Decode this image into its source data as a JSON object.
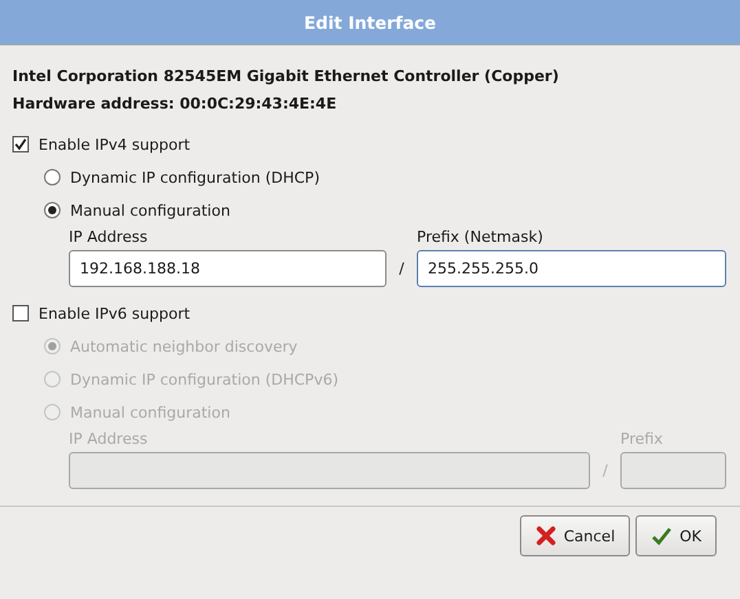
{
  "window": {
    "title": "Edit Interface"
  },
  "device": {
    "name": "Intel Corporation 82545EM Gigabit Ethernet Controller (Copper)",
    "hardware_address": "Hardware address: 00:0C:29:43:4E:4E"
  },
  "sections": [
    {
      "label": "Enable IPv4 support",
      "checked": true,
      "options": [
        {
          "label": "Dynamic IP configuration (DHCP)",
          "selected": false,
          "disabled": false
        },
        {
          "label": "Manual configuration",
          "selected": true,
          "disabled": false
        }
      ],
      "fields": {
        "address_label": "IP Address",
        "address_value": "192.168.188.18",
        "separator": "/",
        "prefix_label": "Prefix (Netmask)",
        "prefix_value": "255.255.255.0",
        "prefix_focused": true,
        "disabled": false
      }
    },
    {
      "label": "Enable IPv6 support",
      "checked": false,
      "options": [
        {
          "label": "Automatic neighbor discovery",
          "selected": true,
          "disabled": true
        },
        {
          "label": "Dynamic IP configuration (DHCPv6)",
          "selected": false,
          "disabled": true
        },
        {
          "label": "Manual configuration",
          "selected": false,
          "disabled": true
        }
      ],
      "fields": {
        "address_label": "IP Address",
        "separator": "/",
        "prefix_label": "Prefix",
        "prefix_focused": false,
        "disabled": true
      }
    }
  ],
  "buttons": [
    {
      "label": "Cancel",
      "kind": "cancel"
    },
    {
      "label": "OK",
      "kind": "ok"
    }
  ]
}
